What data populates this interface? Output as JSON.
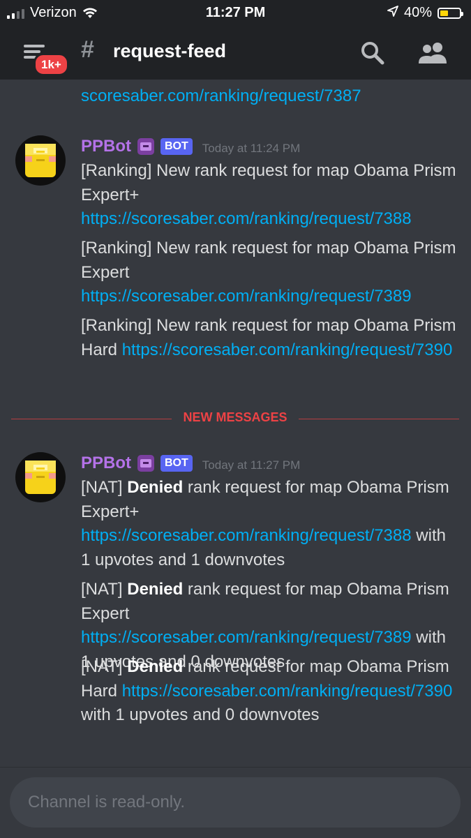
{
  "status_bar": {
    "carrier": "Verizon",
    "time": "11:27 PM",
    "battery_percent": "40%"
  },
  "header": {
    "hash": "#",
    "channel": "request-feed",
    "badge": "1k+"
  },
  "messages": {
    "partial_link": "scoresaber.com/ranking/request/7387",
    "divider_label": "NEW MESSAGES",
    "groups": [
      {
        "author": "PPBot",
        "bot_tag": "BOT",
        "timestamp": "Today at 11:24 PM",
        "items": [
          {
            "prefix": "[Ranking] New rank request for map Obama Prism Expert+ ",
            "link": "https://scoresaber.com/ranking/request/7388"
          },
          {
            "prefix": "[Ranking] New rank request for map Obama Prism Expert ",
            "link": "https://scoresaber.com/ranking/request/7389"
          },
          {
            "prefix": "[Ranking] New rank request for map Obama Prism Hard ",
            "link": "https://scoresaber.com/ranking/request/7390"
          }
        ]
      },
      {
        "author": "PPBot",
        "bot_tag": "BOT",
        "timestamp": "Today at 11:27 PM",
        "items": [
          {
            "tag": "[NAT] ",
            "bold": "Denied",
            "prefix": " rank request for map Obama Prism Expert+ ",
            "link": "https://scoresaber.com/ranking/request/7388",
            "suffix": " with 1 upvotes and 1 downvotes"
          },
          {
            "tag": "[NAT] ",
            "bold": "Denied",
            "prefix": " rank request for map Obama Prism Expert ",
            "link": "https://scoresaber.com/ranking/request/7389",
            "suffix": " with 1 upvotes and 0 downvotes"
          },
          {
            "tag": "[NAT] ",
            "bold": "Denied",
            "prefix": " rank request for map Obama Prism Hard ",
            "link": "https://scoresaber.com/ranking/request/7390",
            "suffix": " with 1 upvotes and 0 downvotes"
          }
        ]
      }
    ]
  },
  "composer": {
    "placeholder": "Channel is read-only."
  },
  "colors": {
    "background": "#36393f",
    "header": "#202225",
    "link": "#00aff4",
    "author": "#b472e8",
    "bot_tag": "#5865f2",
    "new_messages": "#ed4245"
  }
}
